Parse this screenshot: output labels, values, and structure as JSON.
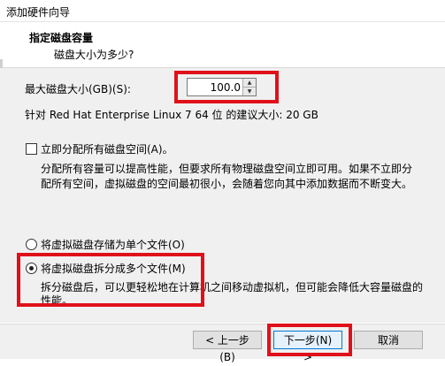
{
  "window": {
    "title": "添加硬件向导"
  },
  "header": {
    "title": "指定磁盘容量",
    "subtitle": "磁盘大小为多少?"
  },
  "disk_size": {
    "label": "最大磁盘大小(GB)(S):",
    "value": "100.0",
    "recommendation": "针对 Red Hat Enterprise Linux 7 64 位 的建议大小: 20 GB"
  },
  "allocate": {
    "label": "立即分配所有磁盘空间(A)。",
    "checked": false,
    "description": "分配所有容量可以提高性能，但要求所有物理磁盘空间立即可用。如果不立即分配所有空间，虚拟磁盘的空间最初很小，会随着您向其中添加数据而不断变大。"
  },
  "storage_options": [
    {
      "label": "将虚拟磁盘存储为单个文件(O)",
      "selected": false
    },
    {
      "label": "将虚拟磁盘拆分成多个文件(M)",
      "selected": true
    }
  ],
  "split_description": "拆分磁盘后，可以更轻松地在计算机之间移动虚拟机，但可能会降低大容量磁盘的性能。",
  "buttons": {
    "back": "< 上一步(B)",
    "next": "下一步(N) >",
    "cancel": "取消"
  },
  "colors": {
    "highlight": "#e0101a",
    "focus_border": "#0078d7",
    "dialog_bg": "#f0f0f0"
  }
}
